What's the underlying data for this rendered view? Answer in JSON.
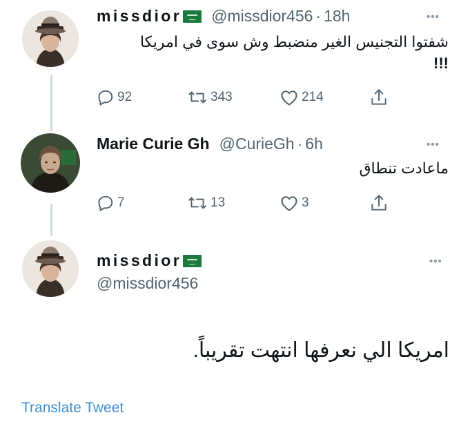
{
  "tweets": [
    {
      "name": "missdior",
      "handle": "@missdior456",
      "separator": "·",
      "time": "18h",
      "text_line1": "شفتوا التجنيس الغير منضبط وش سوى في امريكا",
      "text_line2": "!!!",
      "replies": "92",
      "retweets": "343",
      "likes": "214"
    },
    {
      "name": "Marie Curie Gh",
      "handle": "@CurieGh",
      "separator": "·",
      "time": "6h",
      "text_line1": "ماعادت تنطاق",
      "replies": "7",
      "retweets": "13",
      "likes": "3"
    }
  ],
  "main_tweet": {
    "name": "missdior",
    "handle": "@missdior456",
    "text": "امريكا الي نعرفها انتهت تقريباً."
  },
  "more_label": "•••",
  "translate_label": "Translate Tweet",
  "colors": {
    "text": "#0f1419",
    "muted": "#536471",
    "link": "#3f8fd0",
    "thread_line": "#cfd9de",
    "flag_green": "#1c7a3e"
  },
  "icons": [
    "reply-icon",
    "retweet-icon",
    "like-icon",
    "share-icon",
    "more-icon",
    "saudi-flag-icon"
  ]
}
